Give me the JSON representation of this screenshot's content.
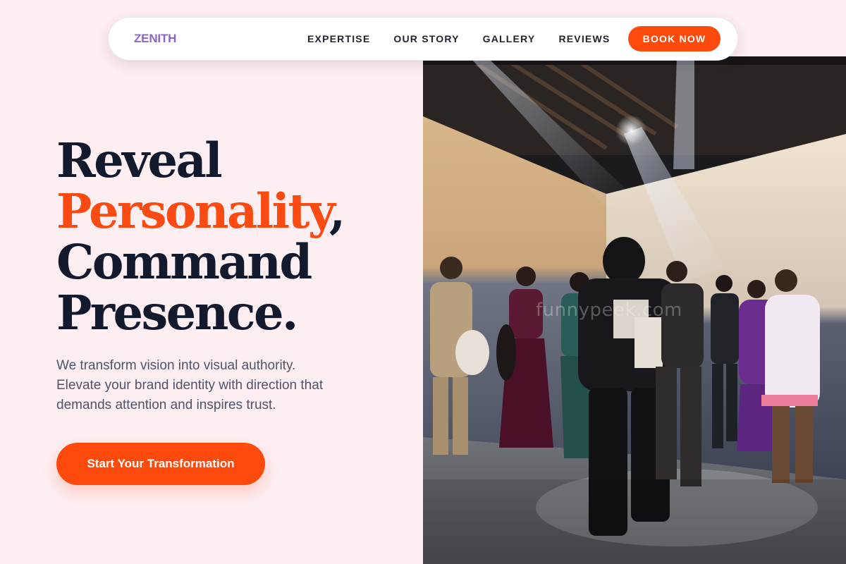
{
  "navbar": {
    "brand": "ZENITH",
    "links": [
      "EXPERTISE",
      "OUR STORY",
      "GALLERY",
      "REVIEWS"
    ],
    "cta": "BOOK NOW"
  },
  "hero": {
    "headline": {
      "line1": "Reveal",
      "accent": "Personality",
      "accent_suffix": ",",
      "line3": "Command",
      "line4": "Presence."
    },
    "subtext": [
      "We transform vision into visual authority.",
      "Elevate your brand identity with direction that",
      "demands attention and inspires trust."
    ],
    "cta": "Start Your Transformation",
    "photo": {
      "watermark": "funnypeek.com"
    }
  },
  "colors": {
    "background": "#fdeef2",
    "accent": "#ff4a0e",
    "brand": "#8f63cf",
    "heading": "#131a2e",
    "body_text": "#4f5467"
  }
}
